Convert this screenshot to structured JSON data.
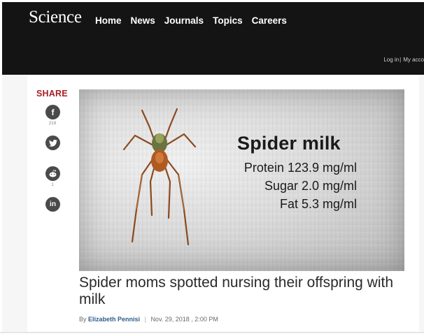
{
  "header": {
    "logo": "Science",
    "nav": [
      "Home",
      "News",
      "Journals",
      "Topics",
      "Careers"
    ],
    "login": "Log in",
    "separator": "|",
    "my_account": "My acco"
  },
  "share": {
    "title": "SHARE",
    "buttons": [
      {
        "icon": "facebook-icon",
        "glyph": "f",
        "count": "218"
      },
      {
        "icon": "twitter-icon",
        "glyph": "t",
        "count": ""
      },
      {
        "icon": "reddit-icon",
        "glyph": "r",
        "count": "1"
      },
      {
        "icon": "linkedin-icon",
        "glyph": "in",
        "count": ""
      }
    ]
  },
  "hero": {
    "title": "Spider milk",
    "lines": [
      "Protein 123.9 mg/ml",
      "Sugar 2.0 mg/ml",
      "Fat 5.3 mg/ml"
    ]
  },
  "article": {
    "headline": "Spider moms spotted nursing their offspring with milk",
    "byline_prefix": "By",
    "author": "Elizabeth Pennisi",
    "date": "Nov. 29, 2018 , 2:00 PM"
  },
  "colors": {
    "header_bg": "#141414",
    "share_red": "#a81d26",
    "author_link": "#2e5c8a"
  }
}
